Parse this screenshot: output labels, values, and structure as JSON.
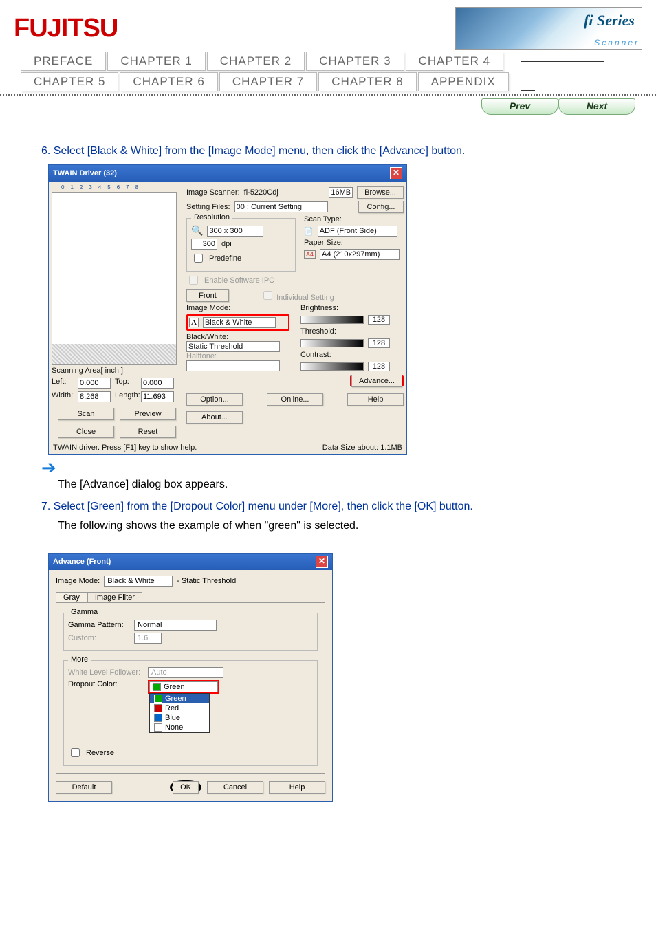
{
  "header": {
    "logo_text": "FUJITSU",
    "banner_series": "fi Series",
    "banner_sub": "Scanner"
  },
  "nav": {
    "row1": [
      "PREFACE",
      "CHAPTER 1",
      "CHAPTER 2",
      "CHAPTER 3",
      "CHAPTER 4"
    ],
    "row2": [
      "CHAPTER 5",
      "CHAPTER 6",
      "CHAPTER 7",
      "CHAPTER 8",
      "APPENDIX"
    ]
  },
  "pager": {
    "prev": "Prev",
    "next": "Next"
  },
  "steps": {
    "s6": "6. Select [Black & White] from the [Image Mode] menu, then click the [Advance] button.",
    "s6_sub": "The [Advance] dialog box appears.",
    "s7": "7. Select [Green] from the [Dropout Color] menu under [More], then click the [OK] button.",
    "s7_sub": "The following shows the example of when \"green\" is selected."
  },
  "twain": {
    "title": "TWAIN Driver (32)",
    "ruler_nums": "012345678",
    "scanning_area": "Scanning Area[ inch ]",
    "left_label": "Left:",
    "left_val": "0.000",
    "top_label": "Top:",
    "top_val": "0.000",
    "width_label": "Width:",
    "width_val": "8.268",
    "length_label": "Length:",
    "length_val": "11.693",
    "scan_btn": "Scan",
    "preview_btn": "Preview",
    "close_btn": "Close",
    "reset_btn": "Reset",
    "img_scanner_lbl": "Image Scanner:",
    "img_scanner_val": "fi-5220Cdj",
    "mem": "16MB",
    "browse": "Browse...",
    "setting_files_lbl": "Setting Files:",
    "setting_files_val": "00 : Current Setting",
    "config": "Config...",
    "resolution_lbl": "Resolution",
    "resolution_val": "300 x 300",
    "dpi": "dpi",
    "predefine": "Predefine",
    "enable_ipc": "Enable Software IPC",
    "front_tab": "Front",
    "individual": "Individual Setting",
    "scan_type_lbl": "Scan Type:",
    "scan_type_val": "ADF (Front Side)",
    "paper_size_lbl": "Paper Size:",
    "paper_size_val": "A4 (210x297mm)",
    "image_mode_lbl": "Image Mode:",
    "image_mode_val": "Black & White",
    "bw_lbl": "Black/White:",
    "bw_val": "Static Threshold",
    "halftone_lbl": "Halftone:",
    "brightness_lbl": "Brightness:",
    "brightness_val": "128",
    "threshold_lbl": "Threshold:",
    "threshold_val": "128",
    "contrast_lbl": "Contrast:",
    "contrast_val": "128",
    "advance_btn": "Advance...",
    "option_btn": "Option...",
    "online_btn": "Online...",
    "help_btn": "Help",
    "about_btn": "About...",
    "status_help": "TWAIN driver. Press [F1] key to show help.",
    "data_size_lbl": "Data Size about:",
    "data_size_val": "1.1MB"
  },
  "advance": {
    "title": "Advance (Front)",
    "image_mode_lbl": "Image Mode:",
    "image_mode_val": "Black & White",
    "static_thresh": "- Static Threshold",
    "tab_gray": "Gray",
    "tab_filter": "Image Filter",
    "gamma_title": "Gamma",
    "gamma_pattern_lbl": "Gamma Pattern:",
    "gamma_pattern_val": "Normal",
    "custom_lbl": "Custom:",
    "custom_val": "1.6",
    "more_title": "More",
    "wlf_lbl": "White Level Follower:",
    "wlf_val": "Auto",
    "dropout_lbl": "Dropout Color:",
    "dropout_val": "Green",
    "dd_green": "Green",
    "dd_red": "Red",
    "dd_blue": "Blue",
    "dd_none": "None",
    "reverse": "Reverse",
    "default_btn": "Default",
    "ok_btn": "OK",
    "cancel_btn": "Cancel",
    "help_btn": "Help"
  }
}
